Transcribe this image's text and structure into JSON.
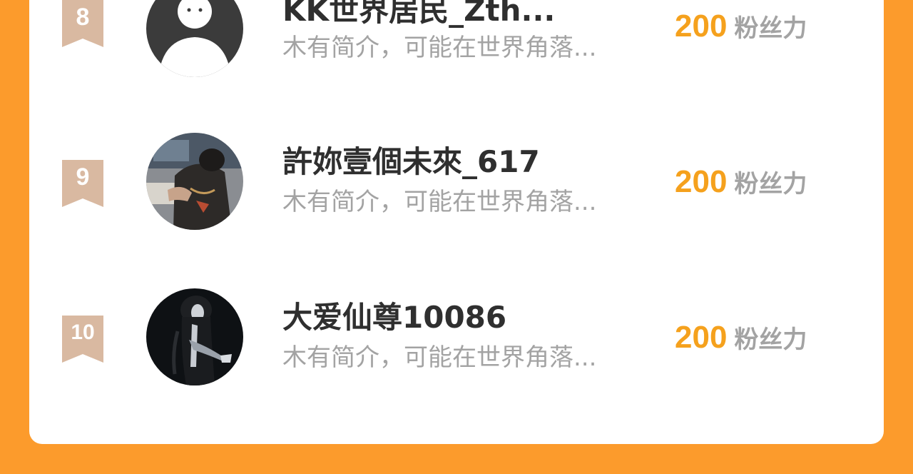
{
  "theme": {
    "background": "#FC9B2C",
    "card": "#FFFFFF",
    "rank_badge": "#D9B9A1",
    "fans_count_color": "#F5A11D",
    "name_color": "#2F2F2F",
    "bio_color": "#A3A3A3"
  },
  "list": [
    {
      "rank": "8",
      "name": "KK世界居民_Zth...",
      "bio": "木有简介，可能在世界角落...",
      "fans_count": "200",
      "fans_unit": "粉丝力",
      "avatar": "default-avatar-icon"
    },
    {
      "rank": "9",
      "name": "許妳壹個未來_617",
      "bio": "木有简介，可能在世界角落...",
      "fans_count": "200",
      "fans_unit": "粉丝力",
      "avatar": "photo-avatar"
    },
    {
      "rank": "10",
      "name": "大爱仙尊10086",
      "bio": "木有简介，可能在世界角落...",
      "fans_count": "200",
      "fans_unit": "粉丝力",
      "avatar": "anime-avatar"
    }
  ]
}
